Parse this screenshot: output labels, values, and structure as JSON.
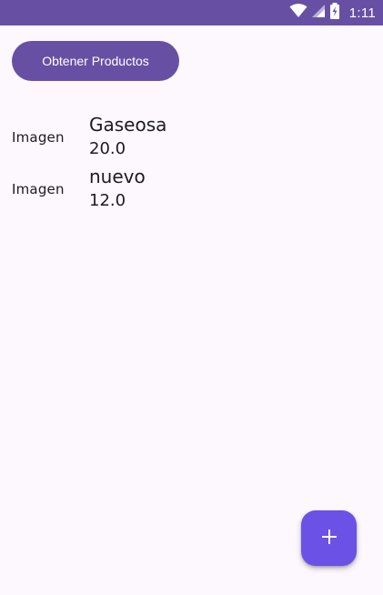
{
  "status_bar": {
    "time": "1:11",
    "icons": [
      "wifi-icon",
      "signal-icon",
      "battery-charging-icon"
    ],
    "background": "#6750a4"
  },
  "toolbar": {
    "get_products_label": "Obtener Productos"
  },
  "products": [
    {
      "image_label": "Imagen",
      "name": "Gaseosa",
      "price": "20.0"
    },
    {
      "image_label": "Imagen",
      "name": "nuevo",
      "price": "12.0"
    }
  ],
  "fab": {
    "icon": "plus-icon",
    "color": "#6b51e6"
  },
  "colors": {
    "primary": "#6750a4",
    "background": "#fdf7fe",
    "text": "#1d1b20"
  }
}
